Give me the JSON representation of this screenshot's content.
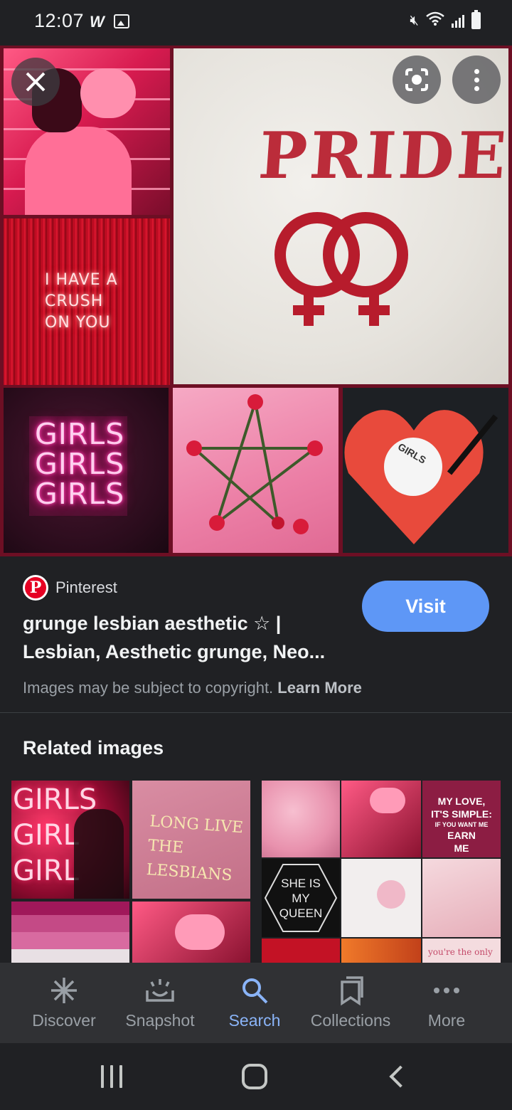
{
  "status_bar": {
    "time": "12:07",
    "app_letter": "W"
  },
  "viewer": {
    "close_icon": "close-icon",
    "lens_icon": "lens-icon",
    "more_icon": "more-vertical-icon",
    "collage_text": {
      "crush_neon": [
        "I HAVE A",
        "CRUSH",
        "ON YOU"
      ],
      "pride": "PRIDE",
      "girls_neon": [
        "GIRLS",
        "GIRLS",
        "GIRLS"
      ],
      "vinyl_label": "GIRLS"
    }
  },
  "result": {
    "source": "Pinterest",
    "source_logo": "P",
    "title": "grunge lesbian aesthetic ☆ | Lesbian, Aesthetic grunge, Neo...",
    "visit_label": "Visit",
    "copyright_text": "Images may be subject to copyright.",
    "learn_more": "Learn More"
  },
  "related": {
    "title": "Related images",
    "image1_text": {
      "girls": [
        "GIRLS",
        "GIRL",
        "GIRL"
      ],
      "long_live": [
        "LONG LIVE",
        "THE LESBIANS"
      ]
    },
    "image2_text": {
      "my_love": [
        "MY LOVE,",
        "IT'S SIMPLE:",
        "IF YOU WANT ME",
        "EARN",
        "ME"
      ],
      "she_is": [
        "SHE IS",
        "MY",
        "QUEEN"
      ],
      "youre": "you're the only"
    }
  },
  "bottom_nav": {
    "items": [
      {
        "label": "Discover",
        "icon": "asterisk-icon"
      },
      {
        "label": "Snapshot",
        "icon": "snapshot-icon"
      },
      {
        "label": "Search",
        "icon": "search-icon"
      },
      {
        "label": "Collections",
        "icon": "collections-icon"
      },
      {
        "label": "More",
        "icon": "more-horizontal-icon"
      }
    ],
    "active": "Search"
  },
  "colors": {
    "accent": "#8ab4f8",
    "visit_button": "#5e97f6",
    "background": "#202124"
  }
}
